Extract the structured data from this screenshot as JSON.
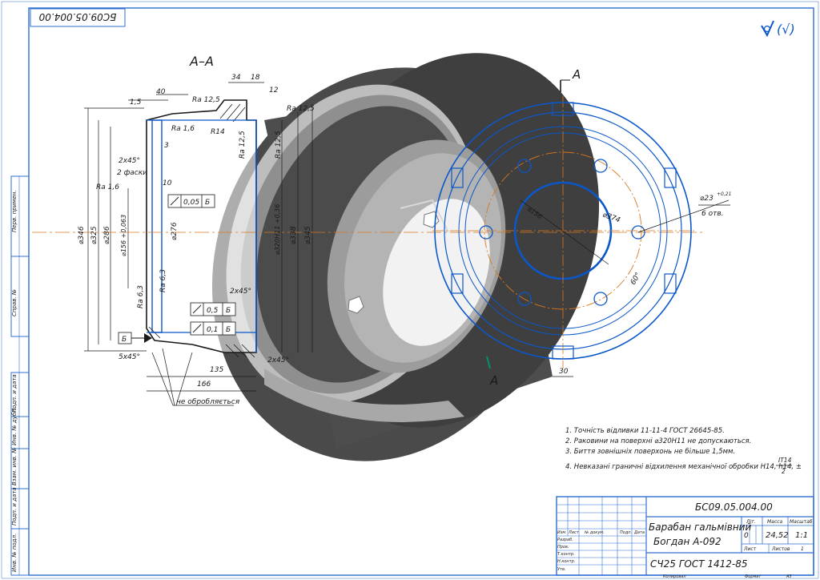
{
  "sheet": {
    "stamp_code": "БС09.05.004.00",
    "roughness_mark": "(√)",
    "section_label": "А–А",
    "view_letter": "А"
  },
  "section_dims": {
    "d1_5": "1,5",
    "d40": "40",
    "d34": "34",
    "d18": "18",
    "d12": "12",
    "ra125a": "Ra 12,5",
    "ra125b": "Ra 12,5",
    "ra16a": "Ra 1,6",
    "ra16b": "Ra 1,6",
    "r14": "R14",
    "ra125v1": "Ra 12,5",
    "ra125v2": "Ra 12,5",
    "chamfer2x45": "2x45°",
    "fasky": "2 фаски",
    "d3": "3",
    "d10": "10",
    "tol005": "0,05",
    "base_b": "Б",
    "d346": "⌀346",
    "d325": "⌀325",
    "d286": "⌀286",
    "d156": "⌀156 +0,063",
    "d276": "⌀276",
    "d320": "⌀320H11 +0,36",
    "d338": "⌀338",
    "d345": "⌀345",
    "ra63a": "Ra 6,3",
    "ra63b": "Ra 6,3",
    "chamfer2x45b": "2x45°",
    "tol05": "0,5",
    "tol01": "0,1",
    "base_b2": "Б",
    "base_b3": "Б",
    "base_b4": "Б",
    "chamfer5x45": "5x45°",
    "chamfer2x45c": "2x45°",
    "d135": "135",
    "d166": "166",
    "not_machined": "не обробляється"
  },
  "view_dims": {
    "d374": "⌀374",
    "d23": "⌀23",
    "d23_tol": "+0,21",
    "holes": "6 отв.",
    "d156v": "⌀156",
    "angle60": "60°",
    "d30": "30"
  },
  "notes": [
    "1. Точність відливки 11-11-4 ГОСТ 26645-85.",
    "2. Раковини на поверхні ⌀320Н11 не допускаються.",
    "3. Биття зовнішніх поверхонь не більше 1,5мм.",
    "4. Невказані граничні відхилення механічної обробки Н14, h14, ±"
  ],
  "note4_fraction": {
    "num": "IT14",
    "den": "2"
  },
  "side_stamp": [
    "Перв. примен.",
    "Справ. №",
    "Подп. и дата",
    "Инв. № дубл.",
    "Взам. инв. №",
    "Подп. и дата",
    "Инв. № подл."
  ],
  "title_block": {
    "code": "БС09.05.004.00",
    "name_line1": "Барабан гальмівний",
    "name_line2": "Богдан А-092",
    "material": "СЧ25  ГОСТ 1412-85",
    "col_lit": "Літ.",
    "col_mass": "Масса",
    "col_scale": "Масштаб",
    "mass": "24,52",
    "scale": "1:1",
    "lit": "0",
    "sheet_label": "Лист",
    "sheets_label": "Листов",
    "sheets_count": "1",
    "row_headers": [
      "Изм",
      "Лист",
      "№ докум.",
      "Подп.",
      "Дата"
    ],
    "roles": [
      "Разраб.",
      "Пров.",
      "Т.контр.",
      "Н.контр.",
      "Утв."
    ],
    "copied": "Копировал",
    "format_label": "Формат",
    "format_value": "А3"
  }
}
